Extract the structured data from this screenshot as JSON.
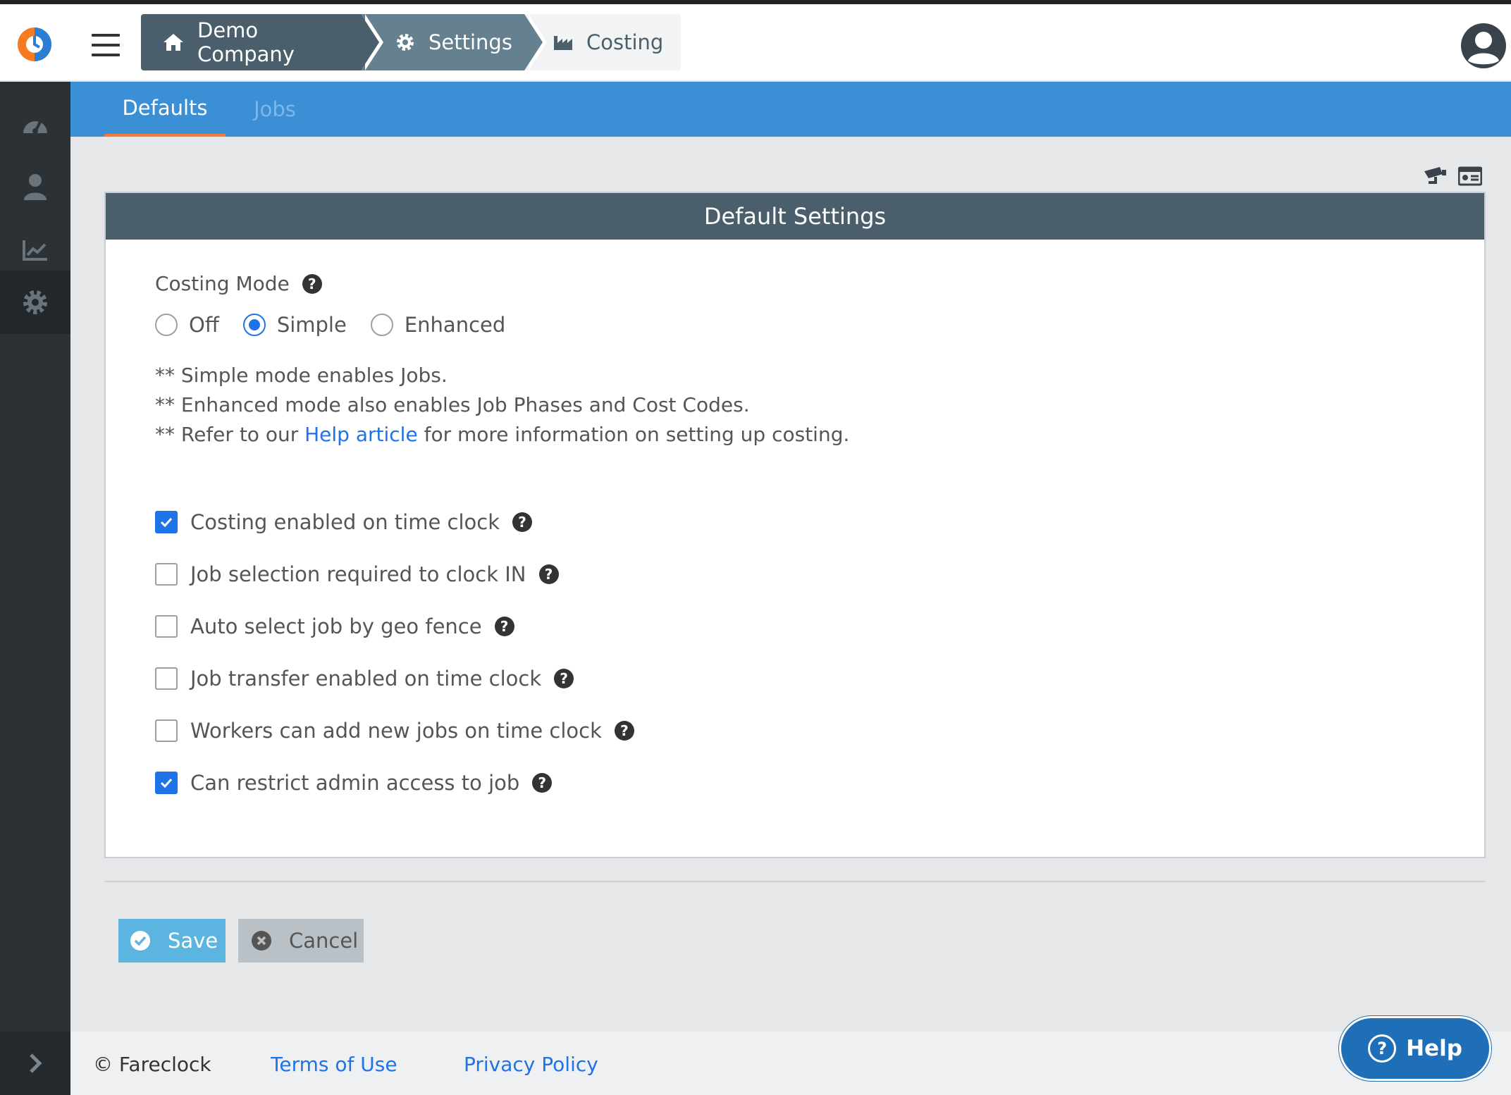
{
  "breadcrumbs": [
    {
      "label": "Demo Company",
      "icon": "home-icon"
    },
    {
      "label": "Settings",
      "icon": "gear-icon"
    },
    {
      "label": "Costing",
      "icon": "factory-icon"
    }
  ],
  "sidebar": {
    "items": [
      {
        "icon": "dashboard-icon"
      },
      {
        "icon": "worker-icon"
      },
      {
        "icon": "chart-icon"
      },
      {
        "icon": "gear-icon",
        "active": true
      }
    ],
    "expand_icon": "chevron-right-icon"
  },
  "tabs": [
    {
      "label": "Defaults",
      "active": true
    },
    {
      "label": "Jobs",
      "active": false
    }
  ],
  "panel": {
    "title": "Default Settings",
    "costing_mode": {
      "label": "Costing Mode",
      "options": [
        {
          "label": "Off",
          "selected": false
        },
        {
          "label": "Simple",
          "selected": true
        },
        {
          "label": "Enhanced",
          "selected": false
        }
      ]
    },
    "notes": {
      "line1": "** Simple mode enables Jobs.",
      "line2": "** Enhanced mode also enables Job Phases and Cost Codes.",
      "line3_prefix": "** Refer to our ",
      "line3_link": "Help article",
      "line3_suffix": " for more information on setting up costing."
    },
    "checkboxes": [
      {
        "label": "Costing enabled on time clock",
        "checked": true
      },
      {
        "label": "Job selection required to clock IN",
        "checked": false
      },
      {
        "label": "Auto select job by geo fence",
        "checked": false
      },
      {
        "label": "Job transfer enabled on time clock",
        "checked": false
      },
      {
        "label": "Workers can add new jobs on time clock",
        "checked": false
      },
      {
        "label": "Can restrict admin access to job",
        "checked": true
      }
    ]
  },
  "buttons": {
    "save": "Save",
    "cancel": "Cancel"
  },
  "footer": {
    "copyright": "© Fareclock",
    "terms": "Terms of Use",
    "privacy": "Privacy Policy"
  },
  "help_button": {
    "label": "Help",
    "glyph": "?"
  },
  "qmark_glyph": "?",
  "colors": {
    "accent": "#1f73e8",
    "tabbar": "#3a8fd5",
    "header": "#4b5e6b",
    "help": "#1e6fb8",
    "tab_indicator": "#f07a3a"
  }
}
